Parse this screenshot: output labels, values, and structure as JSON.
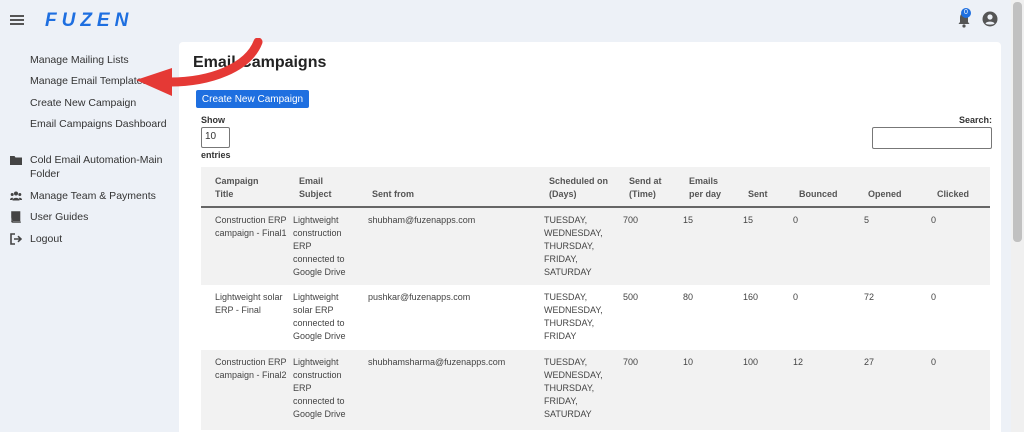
{
  "app": {
    "logo": "FUZEN",
    "notification_count": "0"
  },
  "sidebar": {
    "items": [
      {
        "label": "Manage Mailing Lists",
        "icon": ""
      },
      {
        "label": "Manage Email Templates",
        "icon": ""
      },
      {
        "label": "Create New Campaign",
        "icon": ""
      },
      {
        "label": "Email Campaigns Dashboard",
        "icon": ""
      },
      {
        "label": "Cold Email Automation-Main Folder",
        "icon": "folder-icon"
      },
      {
        "label": "Manage Team & Payments",
        "icon": "users-icon"
      },
      {
        "label": "User Guides",
        "icon": "book-icon"
      },
      {
        "label": "Logout",
        "icon": "logout-icon"
      }
    ]
  },
  "main": {
    "title": "Email Campaigns",
    "create_button": "Create New Campaign",
    "show_label": "Show",
    "show_value": "10",
    "entries_label": "entries",
    "search_label": "Search:",
    "search_value": ""
  },
  "table": {
    "headers": [
      "Campaign Title",
      "Email Subject",
      "Sent from",
      "Scheduled on (Days)",
      "Send at (Time)",
      "Emails per day",
      "Sent",
      "Bounced",
      "Opened",
      "Clicked"
    ],
    "rows": [
      [
        "Construction ERP campaign - Final1",
        "Lightweight construction ERP connected to Google Drive",
        "shubham@fuzenapps.com",
        "TUESDAY, WEDNESDAY, THURSDAY, FRIDAY, SATURDAY",
        "700",
        "15",
        "15",
        "0",
        "5",
        "0"
      ],
      [
        "Lightweight solar ERP - Final",
        "Lightweight solar ERP connected to Google Drive",
        "pushkar@fuzenapps.com",
        "TUESDAY, WEDNESDAY, THURSDAY, FRIDAY",
        "500",
        "80",
        "160",
        "0",
        "72",
        "0"
      ],
      [
        "Construction ERP campaign - Final2",
        "Lightweight construction ERP connected to Google Drive",
        "shubhamsharma@fuzenapps.com",
        "TUESDAY, WEDNESDAY, THURSDAY, FRIDAY, SATURDAY",
        "700",
        "10",
        "100",
        "12",
        "27",
        "0"
      ]
    ]
  },
  "colors": {
    "accent": "#1e6fe0",
    "arrow": "#e53935"
  }
}
